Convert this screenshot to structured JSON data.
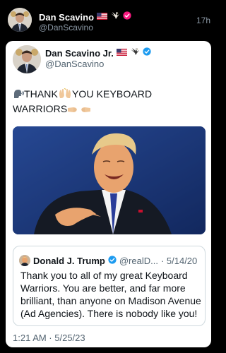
{
  "outer_post": {
    "name": "Dan Scavino",
    "handle": "@DanScavino",
    "time": "17h"
  },
  "embedded_post": {
    "name": "Dan Scavino Jr.",
    "handle": "@DanScavino",
    "text_part1": "THANK",
    "text_part2": "YOU KEYBOARD",
    "text_part3": "WARRIORS",
    "timestamp": "1:21 AM · 5/25/23"
  },
  "quoted_post": {
    "name": "Donald J. Trump",
    "handle": "@realD...",
    "date": "· 5/14/20",
    "text": "Thank you to all of my great Keyboard Warriors. You are better, and far more brilliant, than anyone on Madison Avenue (Ad Agencies). There is nobody like you!"
  },
  "colors": {
    "background": "#000000",
    "card": "#ffffff",
    "verified_blue": "#1d9bf0",
    "verified_pink": "#f91880",
    "muted_text": "#536471"
  },
  "icons": [
    "us-flag-icon",
    "eagle-icon",
    "verified-badge-icon",
    "speaking-head-icon",
    "raised-hands-icon",
    "fist-bump-icon"
  ]
}
